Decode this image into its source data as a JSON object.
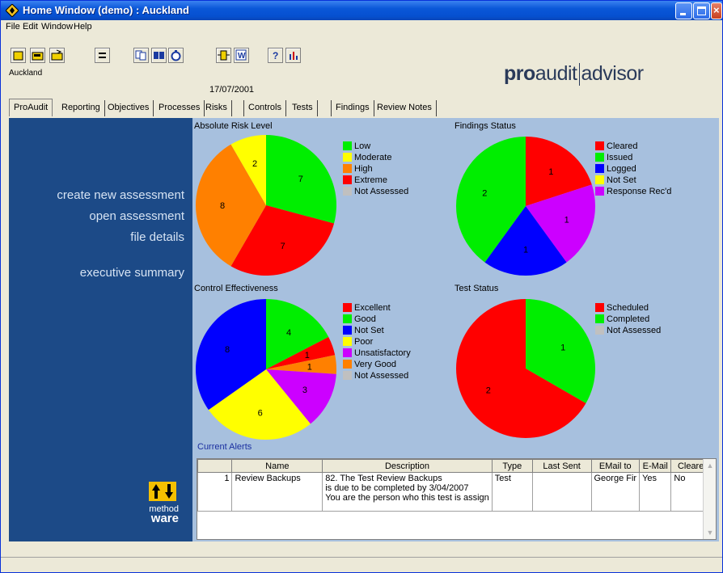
{
  "window": {
    "title": "Home Window (demo) : Auckland"
  },
  "menu": [
    "File",
    "Edit",
    "Window",
    "Help"
  ],
  "header": {
    "location": "Auckland",
    "date": "17/07/2001"
  },
  "logo": {
    "pro": "pro",
    "audit": "audit",
    "advisor": "advisor"
  },
  "tabs": [
    "ProAudit",
    "Reporting",
    "Objectives",
    "Processes",
    "Risks",
    "Controls",
    "Tests",
    "Findings",
    "Review Notes"
  ],
  "sidebar": {
    "links": [
      "create new assessment",
      "open assessment",
      "file details",
      "executive summary"
    ],
    "brand_line1": "method",
    "brand_line2": "ware"
  },
  "charts": {
    "risk": {
      "title": "Absolute Risk Level",
      "legend": [
        {
          "label": "Low",
          "color": "#00ee00"
        },
        {
          "label": "Moderate",
          "color": "#ffff00"
        },
        {
          "label": "High",
          "color": "#ff8000"
        },
        {
          "label": "Extreme",
          "color": "#ff0000"
        },
        {
          "label": "Not Assessed",
          "color": "#c0c0c0"
        }
      ]
    },
    "findings": {
      "title": "Findings Status",
      "legend": [
        {
          "label": "Cleared",
          "color": "#ff0000"
        },
        {
          "label": "Issued",
          "color": "#00ee00"
        },
        {
          "label": "Logged",
          "color": "#0000ff"
        },
        {
          "label": "Not Set",
          "color": "#ffff00"
        },
        {
          "label": "Response Rec'd",
          "color": "#cc00ff"
        }
      ]
    },
    "control": {
      "title": "Control Effectiveness",
      "legend": [
        {
          "label": "Excellent",
          "color": "#ff0000"
        },
        {
          "label": "Good",
          "color": "#00ee00"
        },
        {
          "label": "Not Set",
          "color": "#0000ff"
        },
        {
          "label": "Poor",
          "color": "#ffff00"
        },
        {
          "label": "Unsatisfactory",
          "color": "#cc00ff"
        },
        {
          "label": "Very Good",
          "color": "#ff8000"
        },
        {
          "label": "Not Assessed",
          "color": "#c0c0c0"
        }
      ]
    },
    "tests": {
      "title": "Test Status",
      "legend": [
        {
          "label": "Scheduled",
          "color": "#ff0000"
        },
        {
          "label": "Completed",
          "color": "#00ee00"
        },
        {
          "label": "Not Assessed",
          "color": "#c0c0c0"
        }
      ]
    }
  },
  "chart_data": [
    {
      "type": "pie",
      "title": "Absolute Risk Level",
      "categories": [
        "Low",
        "Extreme",
        "High",
        "Moderate"
      ],
      "values": [
        7,
        7,
        8,
        2
      ],
      "colors": [
        "#00ee00",
        "#ff0000",
        "#ff8000",
        "#ffff00"
      ]
    },
    {
      "type": "pie",
      "title": "Findings Status",
      "categories": [
        "Cleared",
        "Response Rec'd",
        "Logged",
        "Issued"
      ],
      "values": [
        1,
        1,
        1,
        2
      ],
      "colors": [
        "#ff0000",
        "#cc00ff",
        "#0000ff",
        "#00ee00"
      ]
    },
    {
      "type": "pie",
      "title": "Control Effectiveness",
      "categories": [
        "Good",
        "Excellent",
        "Very Good",
        "Unsatisfactory",
        "Poor",
        "Not Set"
      ],
      "values": [
        4,
        1,
        1,
        3,
        6,
        8
      ],
      "colors": [
        "#00ee00",
        "#ff0000",
        "#ff8000",
        "#cc00ff",
        "#ffff00",
        "#0000ff"
      ]
    },
    {
      "type": "pie",
      "title": "Test Status",
      "categories": [
        "Completed",
        "Scheduled"
      ],
      "values": [
        1,
        2
      ],
      "colors": [
        "#00ee00",
        "#ff0000"
      ]
    }
  ],
  "alerts": {
    "label": "Current Alerts",
    "columns": [
      "",
      "Name",
      "Description",
      "Type",
      "Last Sent",
      "EMail to",
      "E-Mail",
      "Cleared"
    ],
    "rows": [
      {
        "num": "1",
        "name": "Review Backups",
        "desc1": "82. The Test Review Backups",
        "desc2": "is due to be completed by 3/04/2007",
        "desc3": "You are the person who this test is assign",
        "type": "Test",
        "last_sent": "",
        "email_to": "George Fir",
        "email": "Yes",
        "cleared": "No"
      }
    ]
  }
}
